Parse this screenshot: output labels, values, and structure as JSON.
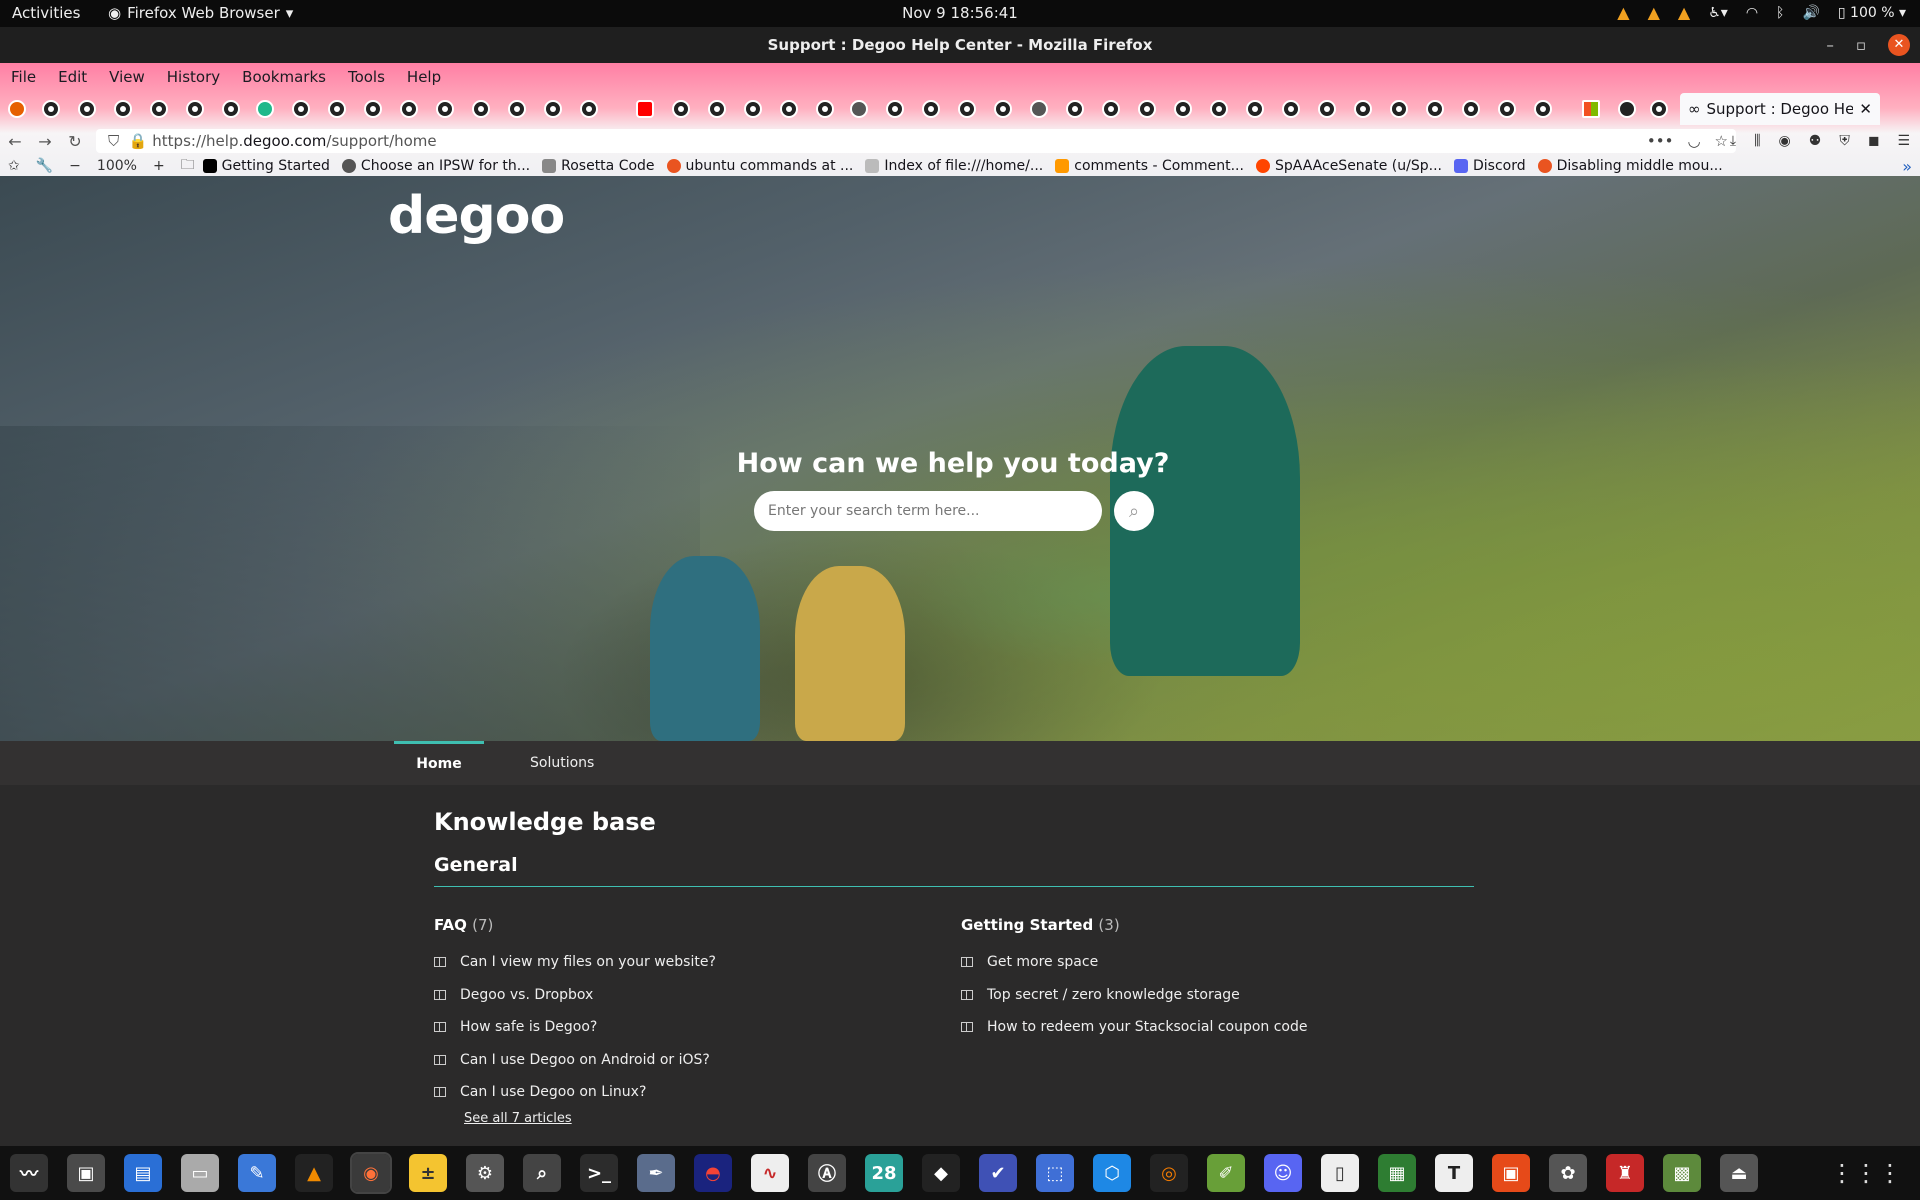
{
  "gnome": {
    "activities": "Activities",
    "app_menu": "Firefox Web Browser",
    "clock": "Nov 9  18:56:41",
    "battery": "100 %"
  },
  "window": {
    "title": "Support : Degoo Help Center - Mozilla Firefox"
  },
  "menubar": [
    "File",
    "Edit",
    "View",
    "History",
    "Bookmarks",
    "Tools",
    "Help"
  ],
  "tab": {
    "title": "Support : Degoo Help"
  },
  "urlbar": {
    "prefix": "https://help.",
    "domain": "degoo.com",
    "path": "/support/home"
  },
  "bookmarks_bar": {
    "zoom": "100%",
    "items": [
      {
        "label": "Getting Started",
        "color": "#000000"
      },
      {
        "label": "Choose an IPSW for th...",
        "color": "#555555"
      },
      {
        "label": "Rosetta Code",
        "color": "#888888"
      },
      {
        "label": "ubuntu commands at ...",
        "color": "#e95420"
      },
      {
        "label": "Index of file:///home/...",
        "color": "#bbbbbb"
      },
      {
        "label": "comments - Comment...",
        "color": "#ff9900"
      },
      {
        "label": "SpAAAceSenate (u/Sp...",
        "color": "#ff4500"
      },
      {
        "label": "Discord",
        "color": "#5865f2"
      },
      {
        "label": "Disabling middle mou...",
        "color": "#e95420"
      }
    ]
  },
  "hero": {
    "logo": "degoo",
    "title": "How can we help you today?",
    "search_placeholder": "Enter your search term here..."
  },
  "subnav": {
    "home": "Home",
    "solutions": "Solutions"
  },
  "kb": {
    "title": "Knowledge base",
    "section": "General",
    "faq": {
      "title": "FAQ",
      "count": "(7)",
      "items": [
        "Can I view my files on your website?",
        "Degoo vs. Dropbox",
        "How safe is Degoo?",
        "Can I use Degoo on Android or iOS?",
        "Can I use Degoo on Linux?"
      ],
      "more": "See all 7 articles"
    },
    "getting_started": {
      "title": "Getting Started",
      "count": "(3)",
      "items": [
        "Get more space",
        "Top secret / zero knowledge storage",
        "How to redeem your Stacksocial coupon code"
      ]
    }
  },
  "dock": {
    "calendar_day": "28"
  },
  "colors": {
    "accent": "#3fbfb1",
    "firefox_pink": "#ff7fa4",
    "page_bg": "#2b2a2a"
  }
}
